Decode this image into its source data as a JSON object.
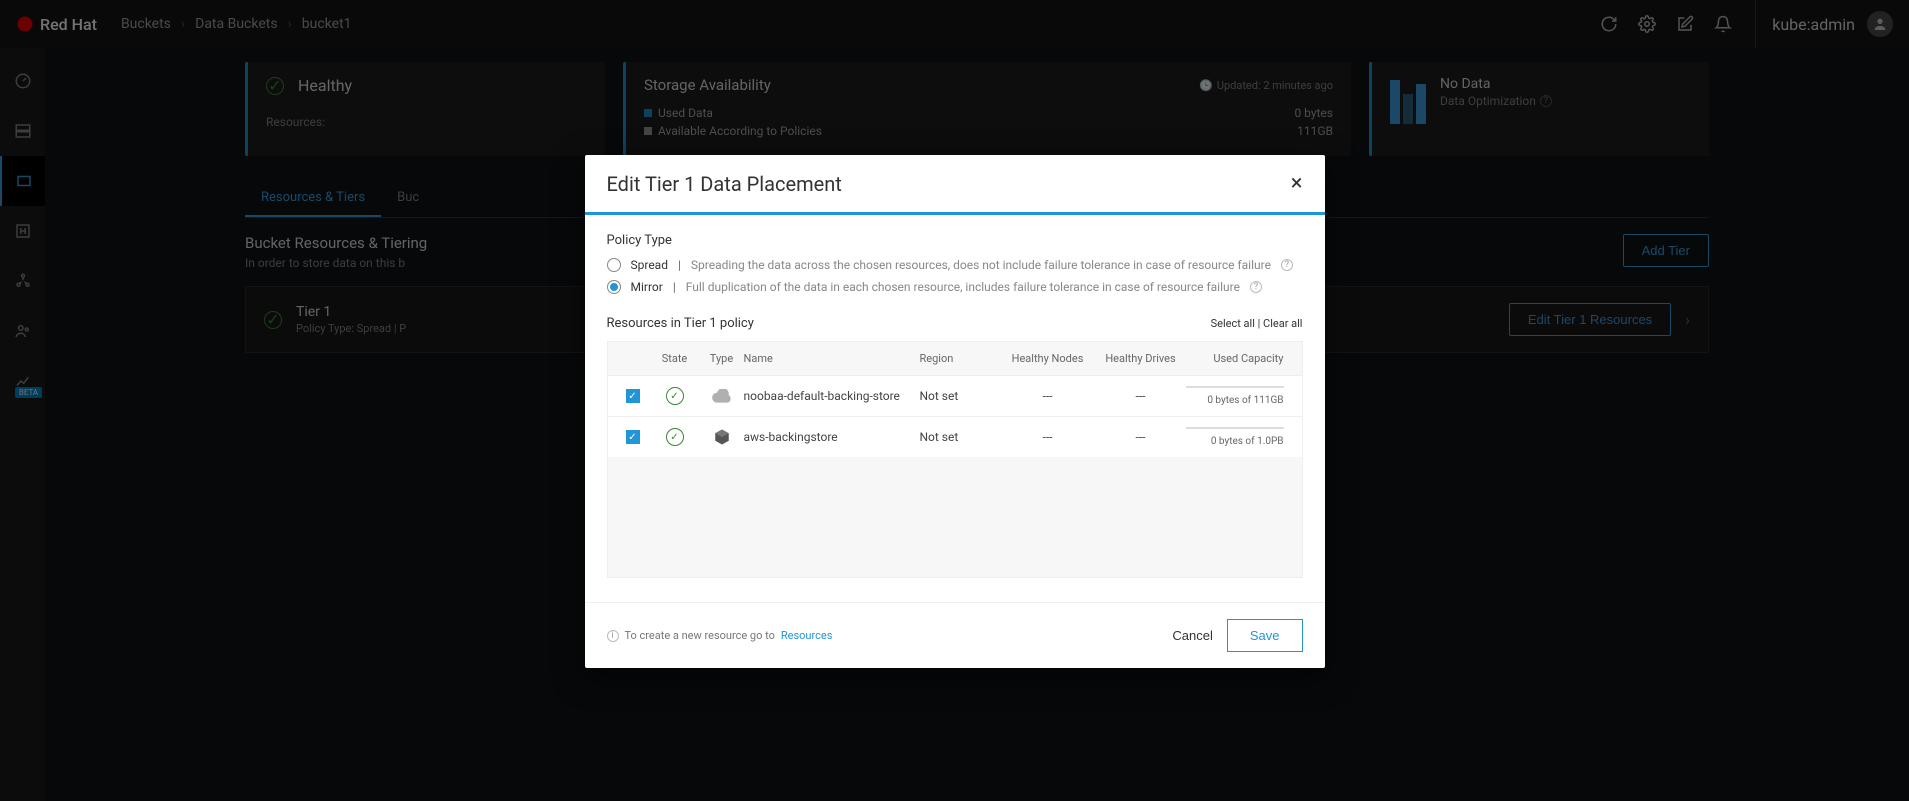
{
  "brand": "Red Hat",
  "breadcrumb": [
    "Buckets",
    "Data Buckets",
    "bucket1"
  ],
  "user": "kube:admin",
  "health": {
    "status": "Healthy",
    "resources_label": "Resources:"
  },
  "storage": {
    "title": "Storage Availability",
    "updated": "Updated: 2 minutes ago",
    "used_label": "Used Data",
    "used_value": "0 bytes",
    "avail_label": "Available According to Policies",
    "avail_value": "111GB",
    "colors": {
      "used": "#2196d6",
      "avail": "#9a9a9a"
    }
  },
  "opt": {
    "title": "No Data",
    "sub": "Data Optimization"
  },
  "tabs": {
    "active": "Resources & Tiers",
    "second": "Buc"
  },
  "tiering": {
    "title": "Bucket Resources & Tiering",
    "sub": "In order to store data on this b",
    "add_btn": "Add Tier"
  },
  "tier1": {
    "title": "Tier 1",
    "sub": "Policy Type: Spread  |  P",
    "edit_btn": "Edit Tier 1 Resources"
  },
  "modal": {
    "title": "Edit Tier 1 Data Placement",
    "policy_label": "Policy Type",
    "spread": {
      "label": "Spread",
      "desc": "Spreading the data across the chosen resources, does not include failure tolerance in case of resource failure"
    },
    "mirror": {
      "label": "Mirror",
      "desc": "Full duplication of the data in each chosen resource, includes failure tolerance in case of resource failure"
    },
    "selected_policy": "mirror",
    "res_title": "Resources in Tier 1 policy",
    "select_all": "Select all",
    "clear_all": "Clear all",
    "columns": {
      "state": "State",
      "type": "Type",
      "name": "Name",
      "region": "Region",
      "hn": "Healthy Nodes",
      "hd": "Healthy Drives",
      "cap": "Used Capacity"
    },
    "rows": [
      {
        "checked": true,
        "name": "noobaa-default-backing-store",
        "region": "Not set",
        "hn": "---",
        "hd": "---",
        "cap": "0 bytes of 111GB",
        "icon": "cloud"
      },
      {
        "checked": true,
        "name": "aws-backingstore",
        "region": "Not set",
        "hn": "---",
        "hd": "---",
        "cap": "0 bytes of 1.0PB",
        "icon": "cube"
      }
    ],
    "foot_note_prefix": "To create a new resource go to ",
    "foot_note_link": "Resources",
    "cancel": "Cancel",
    "save": "Save"
  }
}
